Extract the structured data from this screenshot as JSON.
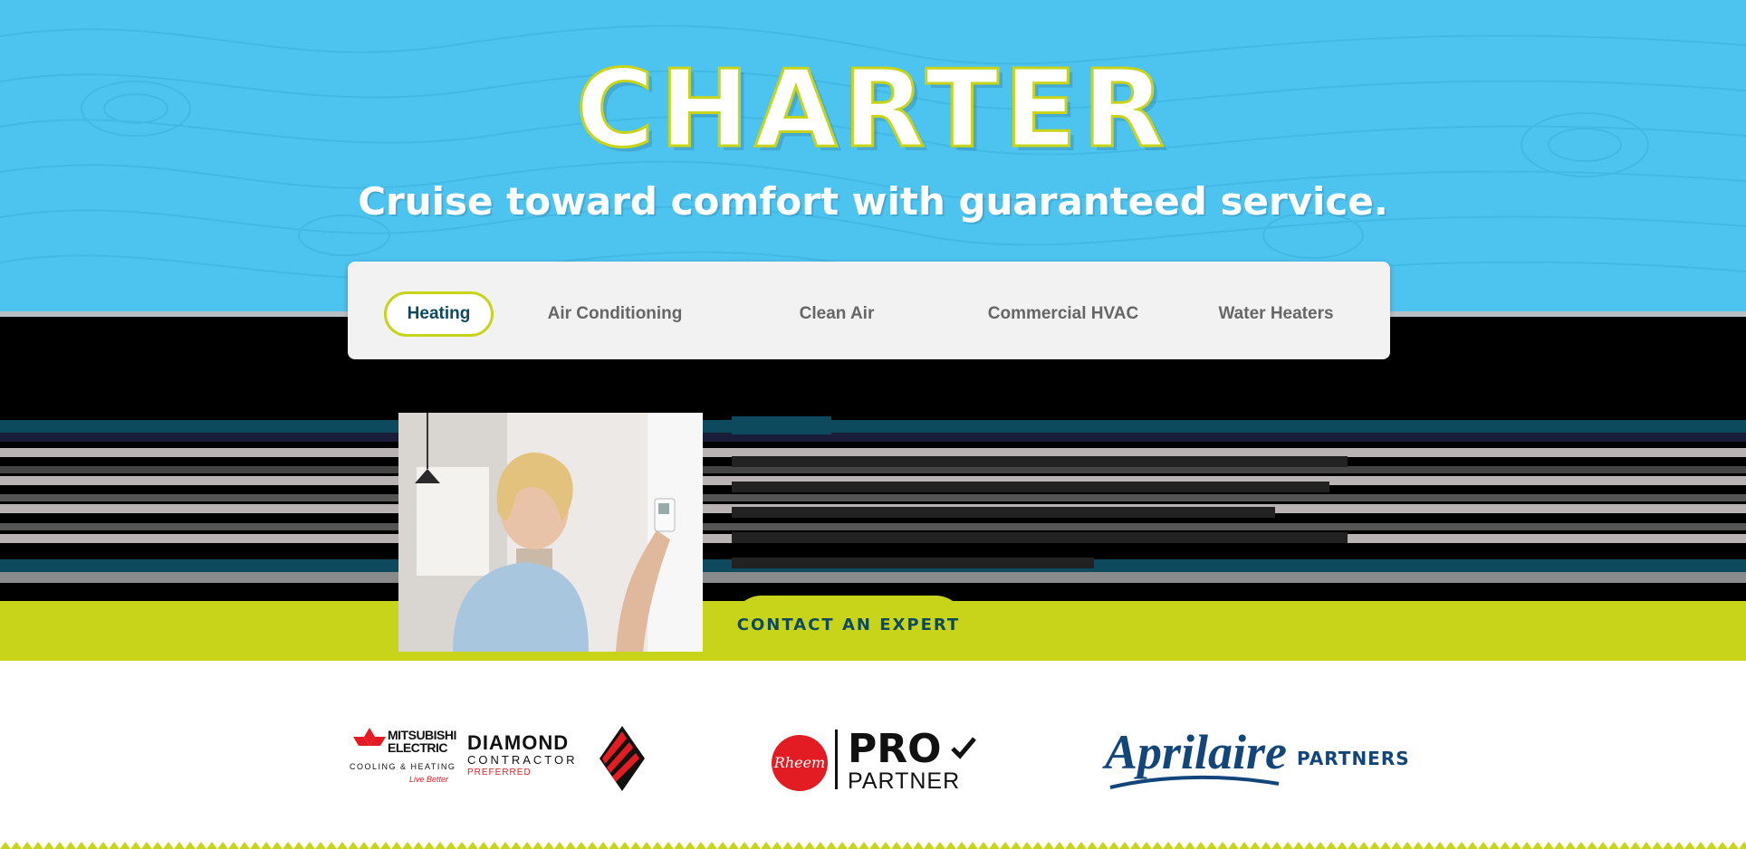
{
  "hero": {
    "brand": "CHARTER",
    "tagline": "Cruise toward comfort with guaranteed service."
  },
  "tabs": [
    {
      "label": "Heating",
      "active": true
    },
    {
      "label": "Air Conditioning",
      "active": false
    },
    {
      "label": "Clean Air",
      "active": false
    },
    {
      "label": "Commercial HVAC",
      "active": false
    },
    {
      "label": "Water Heaters",
      "active": false
    }
  ],
  "content": {
    "cta_label": "CONTACT AN EXPERT"
  },
  "partners": {
    "mitsubishi": {
      "name_line1": "MITSUBISHI",
      "name_line2": "ELECTRIC",
      "sub": "COOLING & HEATING",
      "slogan": "Live Better"
    },
    "diamond": {
      "line1": "DIAMOND",
      "line2": "CONTRACTOR",
      "line3": "PREFERRED"
    },
    "rheem": {
      "badge": "Rheem",
      "pro": "PRO",
      "partner": "PARTNER"
    },
    "aprilaire": {
      "name": "Aprilaire",
      "label": "PARTNERS"
    }
  },
  "colors": {
    "sky": "#4dc3ef",
    "lime": "#c8d41a",
    "navy": "#0d4a5e",
    "aprilaire_blue": "#12467a",
    "rheem_red": "#e31b23"
  }
}
